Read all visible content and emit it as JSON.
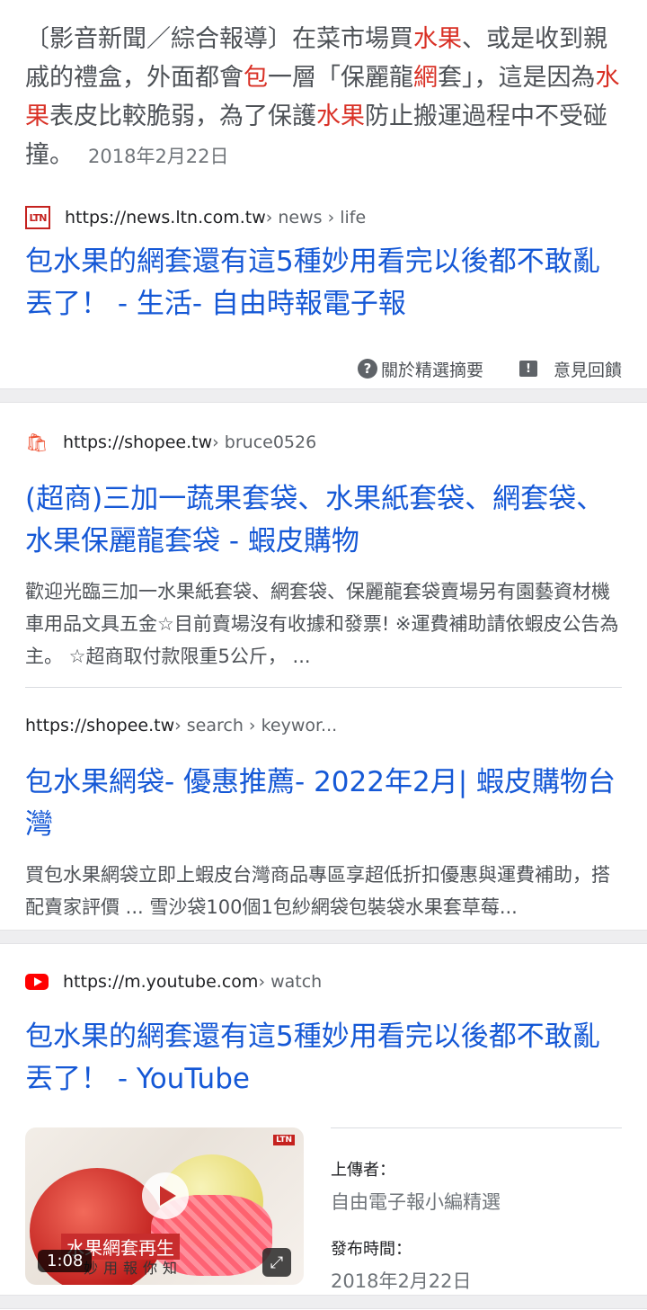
{
  "card1": {
    "snippet_parts": [
      "〔影音新聞／綜合報導〕在菜市場買",
      "水果",
      "、或是收到親戚的禮盒，外面都會",
      "包",
      "一層「保麗龍",
      "網",
      "套」，這是因為",
      "水果",
      "表皮比較脆弱，為了保護",
      "水果",
      "防止搬運過程中不受碰撞。"
    ],
    "date": "2018年2月22日",
    "source_url": "https://news.ltn.com.tw",
    "source_crumb": " › news › life",
    "favicon_text": "LTN",
    "title": "包水果的網套還有這5種妙用看完以後都不敢亂丟了！ - 生活- 自由時報電子報",
    "about_label": "關於精選摘要",
    "feedback_label": "意見回饋"
  },
  "card2": {
    "result1": {
      "source_url": "https://shopee.tw",
      "source_crumb": " › bruce0526",
      "title": "(超商)三加一蔬果套袋、水果紙套袋、網套袋、水果保麗龍套袋 - 蝦皮購物",
      "desc": "歡迎光臨三加一水果紙套袋、網套袋、保麗龍套袋賣場另有園藝資材機車用品文具五金☆目前賣場沒有收據和發票! ※運費補助請依蝦皮公告為主。 ☆超商取付款限重5公斤， ..."
    },
    "result2": {
      "source_url": "https://shopee.tw",
      "source_crumb": " › search › keywor...",
      "title": "包水果網袋- 優惠推薦- 2022年2月| 蝦皮購物台灣",
      "desc": "買包水果網袋立即上蝦皮台灣商品專區享超低折扣優惠與運費補助，搭配賣家評價 ... 雪沙袋100個1包紗網袋包裝袋水果套草莓..."
    }
  },
  "card3": {
    "source_url": "https://m.youtube.com",
    "source_crumb": " › watch",
    "title": "包水果的網套還有這5種妙用看完以後都不敢亂丟了！ - YouTube",
    "video": {
      "duration": "1:08",
      "caption": "水果網套再生",
      "caption_sub": "妙用報你知",
      "channel_mark": "LTN"
    },
    "uploader_label": "上傳者：",
    "uploader": "自由電子報小編精選",
    "published_label": "發布時間：",
    "published": "2018年2月22日"
  },
  "colors": {
    "link": "#1558d6",
    "highlight": "#d93025",
    "meta": "#70757a"
  }
}
